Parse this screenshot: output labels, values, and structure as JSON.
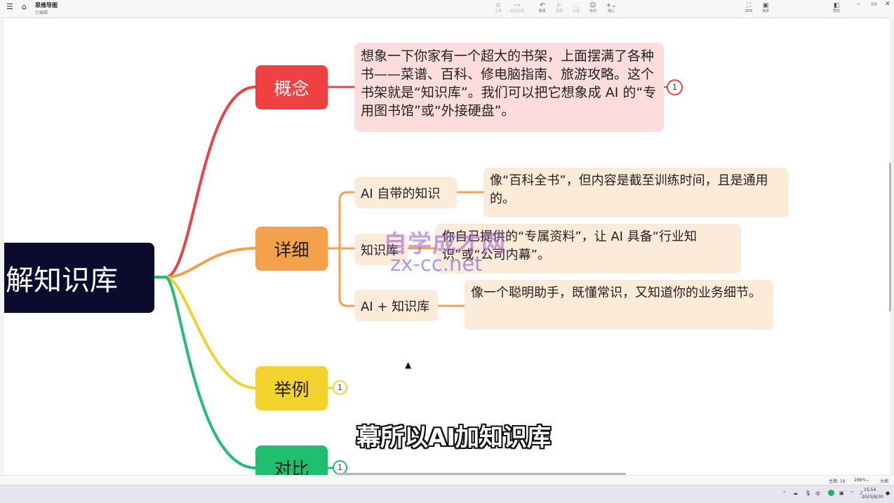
{
  "window": {
    "doc_title": "思维导图",
    "doc_status": "已编辑",
    "menu_icon": "☰",
    "home_icon": "⌂"
  },
  "toolbar": {
    "items": [
      {
        "label": "主题",
        "icon": "⧉"
      },
      {
        "label": "添加主题",
        "icon": "⊶"
      },
      {
        "label": "联系",
        "icon": "↶"
      },
      {
        "label": "概要",
        "icon": "⊱"
      },
      {
        "label": "外框",
        "icon": "⬚"
      },
      {
        "label": "标记",
        "icon": "☺"
      },
      {
        "label": "插入",
        "icon": "+⌄"
      }
    ],
    "right_items": [
      {
        "label": "ZEN",
        "icon": "⛶"
      },
      {
        "label": "演讲",
        "icon": "▣"
      },
      {
        "label": "预览",
        "icon": "◧"
      }
    ],
    "window_controls": [
      "–",
      "▭",
      "✕"
    ]
  },
  "mindmap": {
    "root": "解知识库",
    "branches": {
      "concept": "概念",
      "detail": "详细",
      "example": "举例",
      "compare": "对比"
    },
    "concept_text": "想象一下你家有一个超大的书架，上面摆满了各种书——菜谱、百科、修电脑指南、旅游攻略。这个书架就是“知识库”。我们可以把它想象成 AI 的“专用图书馆”或“外接硬盘”。",
    "detail_subs": [
      {
        "label": "AI 自带的知识",
        "text": "像“百科全书”，但内容是截至训练时间，且是通用的。"
      },
      {
        "label": "知识库",
        "text": "你自己提供的“专属资料”，让 AI 具备“行业知识”或“公司内幕”。"
      },
      {
        "label": "AI + 知识库",
        "text": "像一个聪明助手，既懂常识，又知道你的业务细节。"
      }
    ],
    "badge_concept": "1",
    "badge_example": "1",
    "badge_compare": "1",
    "colors": {
      "root_bg": "#0b0b2e",
      "concept": "#ef4141",
      "detail": "#f5a04a",
      "example": "#f2d22d",
      "compare": "#1fbf6f"
    }
  },
  "overlay": {
    "watermark_line1": "自学成才网",
    "watermark_line2": "zx-cc.net",
    "subtitle": "幕所以AI加知识库"
  },
  "statusbar": {
    "topics": "主题: 16",
    "zoom": "288%",
    "zoom_icon": "⌄",
    "outline": "大纲"
  },
  "taskbar": {
    "ime": "中",
    "time": "15:54",
    "date": "2025/8/30"
  }
}
